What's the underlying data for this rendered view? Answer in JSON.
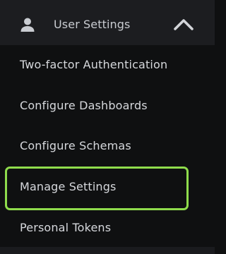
{
  "header": {
    "title": "User Settings",
    "icon": "user-icon",
    "toggle_icon": "chevron-up-icon",
    "expanded": true
  },
  "submenu": {
    "items": [
      {
        "label": "Two-factor Authentication"
      },
      {
        "label": "Configure Dashboards"
      },
      {
        "label": "Configure Schemas"
      },
      {
        "label": "Manage Settings",
        "highlighted": true
      },
      {
        "label": "Personal Tokens"
      }
    ]
  },
  "colors": {
    "header_bg": "#1c1d20",
    "menu_bg": "#0f1011",
    "text": "#d6d8dc",
    "highlight_border": "#8fdc4c"
  }
}
